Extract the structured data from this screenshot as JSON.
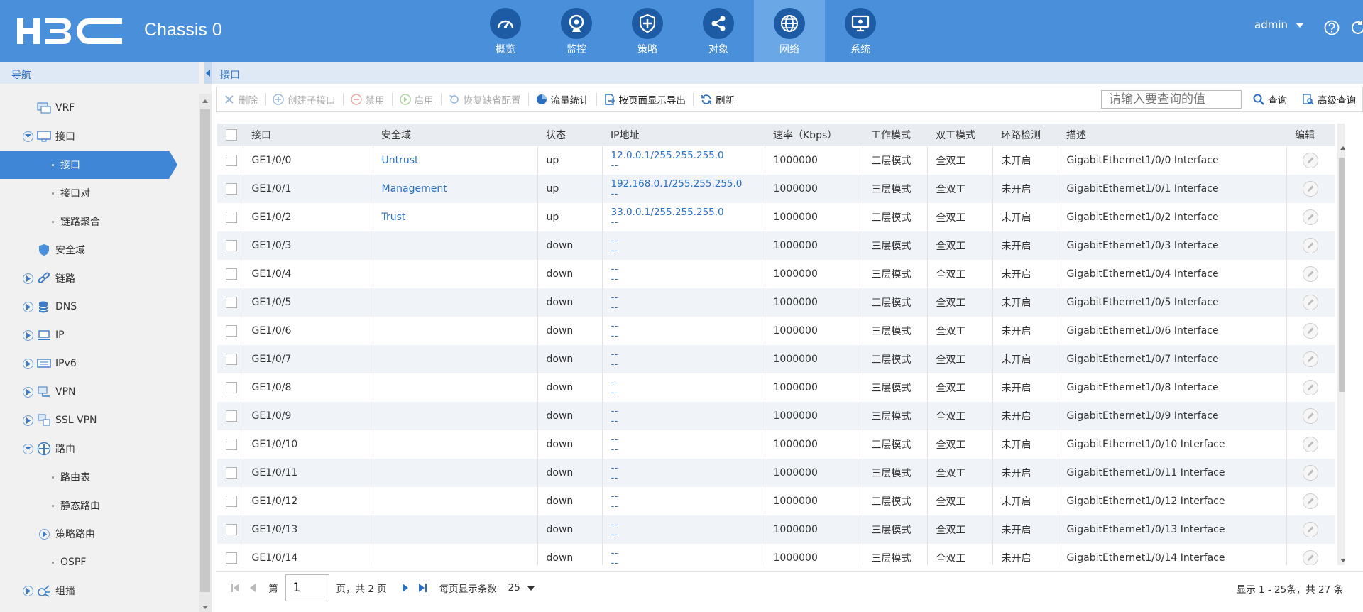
{
  "header": {
    "chassis": "Chassis 0",
    "user": "admin",
    "nav": [
      {
        "label": "概览",
        "icon": "gauge-icon"
      },
      {
        "label": "监控",
        "icon": "camera-icon"
      },
      {
        "label": "策略",
        "icon": "shield-icon"
      },
      {
        "label": "对象",
        "icon": "share-icon"
      },
      {
        "label": "网络",
        "icon": "globe-icon",
        "active": true
      },
      {
        "label": "系统",
        "icon": "monitor-icon"
      }
    ]
  },
  "sidebar": {
    "title": "导航",
    "items": [
      {
        "label": "VRF"
      },
      {
        "label": "接口"
      },
      {
        "label": "接口",
        "active": true
      },
      {
        "label": "接口对"
      },
      {
        "label": "链路聚合"
      },
      {
        "label": "安全域"
      },
      {
        "label": "链路"
      },
      {
        "label": "DNS"
      },
      {
        "label": "IP"
      },
      {
        "label": "IPv6"
      },
      {
        "label": "VPN"
      },
      {
        "label": "SSL VPN"
      },
      {
        "label": "路由"
      },
      {
        "label": "路由表"
      },
      {
        "label": "静态路由"
      },
      {
        "label": "策略路由"
      },
      {
        "label": "OSPF"
      },
      {
        "label": "组播"
      }
    ]
  },
  "breadcrumb": "接口",
  "toolbar": {
    "delete": "删除",
    "create_sub": "创建子接口",
    "disable": "禁用",
    "enable": "启用",
    "restore": "恢复缺省配置",
    "traffic": "流量统计",
    "export": "按页面显示导出",
    "refresh": "刷新",
    "search_placeholder": "请输入要查询的值",
    "search": "查询",
    "advanced": "高级查询"
  },
  "table": {
    "columns": [
      "接口",
      "安全域",
      "状态",
      "IP地址",
      "速率（Kbps）",
      "工作模式",
      "双工模式",
      "环路检测",
      "描述",
      "编辑"
    ],
    "rows": [
      {
        "iface": "GE1/0/0",
        "zone": "Untrust",
        "status": "up",
        "ip": "12.0.0.1/255.255.255.0",
        "ip2": "--",
        "speed": "1000000",
        "mode": "三层模式",
        "duplex": "全双工",
        "loop": "未开启",
        "desc": "GigabitEthernet1/0/0 Interface"
      },
      {
        "iface": "GE1/0/1",
        "zone": "Management",
        "status": "up",
        "ip": "192.168.0.1/255.255.255.0",
        "ip2": "--",
        "speed": "1000000",
        "mode": "三层模式",
        "duplex": "全双工",
        "loop": "未开启",
        "desc": "GigabitEthernet1/0/1 Interface"
      },
      {
        "iface": "GE1/0/2",
        "zone": "Trust",
        "status": "up",
        "ip": "33.0.0.1/255.255.255.0",
        "ip2": "--",
        "speed": "1000000",
        "mode": "三层模式",
        "duplex": "全双工",
        "loop": "未开启",
        "desc": "GigabitEthernet1/0/2 Interface"
      },
      {
        "iface": "GE1/0/3",
        "zone": "",
        "status": "down",
        "ip": "--",
        "ip2": "--",
        "speed": "1000000",
        "mode": "三层模式",
        "duplex": "全双工",
        "loop": "未开启",
        "desc": "GigabitEthernet1/0/3 Interface"
      },
      {
        "iface": "GE1/0/4",
        "zone": "",
        "status": "down",
        "ip": "--",
        "ip2": "--",
        "speed": "1000000",
        "mode": "三层模式",
        "duplex": "全双工",
        "loop": "未开启",
        "desc": "GigabitEthernet1/0/4 Interface"
      },
      {
        "iface": "GE1/0/5",
        "zone": "",
        "status": "down",
        "ip": "--",
        "ip2": "--",
        "speed": "1000000",
        "mode": "三层模式",
        "duplex": "全双工",
        "loop": "未开启",
        "desc": "GigabitEthernet1/0/5 Interface"
      },
      {
        "iface": "GE1/0/6",
        "zone": "",
        "status": "down",
        "ip": "--",
        "ip2": "--",
        "speed": "1000000",
        "mode": "三层模式",
        "duplex": "全双工",
        "loop": "未开启",
        "desc": "GigabitEthernet1/0/6 Interface"
      },
      {
        "iface": "GE1/0/7",
        "zone": "",
        "status": "down",
        "ip": "--",
        "ip2": "--",
        "speed": "1000000",
        "mode": "三层模式",
        "duplex": "全双工",
        "loop": "未开启",
        "desc": "GigabitEthernet1/0/7 Interface"
      },
      {
        "iface": "GE1/0/8",
        "zone": "",
        "status": "down",
        "ip": "--",
        "ip2": "--",
        "speed": "1000000",
        "mode": "三层模式",
        "duplex": "全双工",
        "loop": "未开启",
        "desc": "GigabitEthernet1/0/8 Interface"
      },
      {
        "iface": "GE1/0/9",
        "zone": "",
        "status": "down",
        "ip": "--",
        "ip2": "--",
        "speed": "1000000",
        "mode": "三层模式",
        "duplex": "全双工",
        "loop": "未开启",
        "desc": "GigabitEthernet1/0/9 Interface"
      },
      {
        "iface": "GE1/0/10",
        "zone": "",
        "status": "down",
        "ip": "--",
        "ip2": "--",
        "speed": "1000000",
        "mode": "三层模式",
        "duplex": "全双工",
        "loop": "未开启",
        "desc": "GigabitEthernet1/0/10 Interface"
      },
      {
        "iface": "GE1/0/11",
        "zone": "",
        "status": "down",
        "ip": "--",
        "ip2": "--",
        "speed": "1000000",
        "mode": "三层模式",
        "duplex": "全双工",
        "loop": "未开启",
        "desc": "GigabitEthernet1/0/11 Interface"
      },
      {
        "iface": "GE1/0/12",
        "zone": "",
        "status": "down",
        "ip": "--",
        "ip2": "--",
        "speed": "1000000",
        "mode": "三层模式",
        "duplex": "全双工",
        "loop": "未开启",
        "desc": "GigabitEthernet1/0/12 Interface"
      },
      {
        "iface": "GE1/0/13",
        "zone": "",
        "status": "down",
        "ip": "--",
        "ip2": "--",
        "speed": "1000000",
        "mode": "三层模式",
        "duplex": "全双工",
        "loop": "未开启",
        "desc": "GigabitEthernet1/0/13 Interface"
      },
      {
        "iface": "GE1/0/14",
        "zone": "",
        "status": "down",
        "ip": "--",
        "ip2": "--",
        "speed": "1000000",
        "mode": "三层模式",
        "duplex": "全双工",
        "loop": "未开启",
        "desc": "GigabitEthernet1/0/14 Interface"
      }
    ]
  },
  "pager": {
    "page_prefix": "第",
    "current_page": "1",
    "page_suffix": "页，共 2 页",
    "per_page_label": "每页显示条数",
    "per_page": "25",
    "summary": "显示 1 - 25条，共 27 条"
  },
  "colors": {
    "header": "#4a8fd9",
    "active_nav": "#3f86d6",
    "link": "#2c6fc0"
  }
}
